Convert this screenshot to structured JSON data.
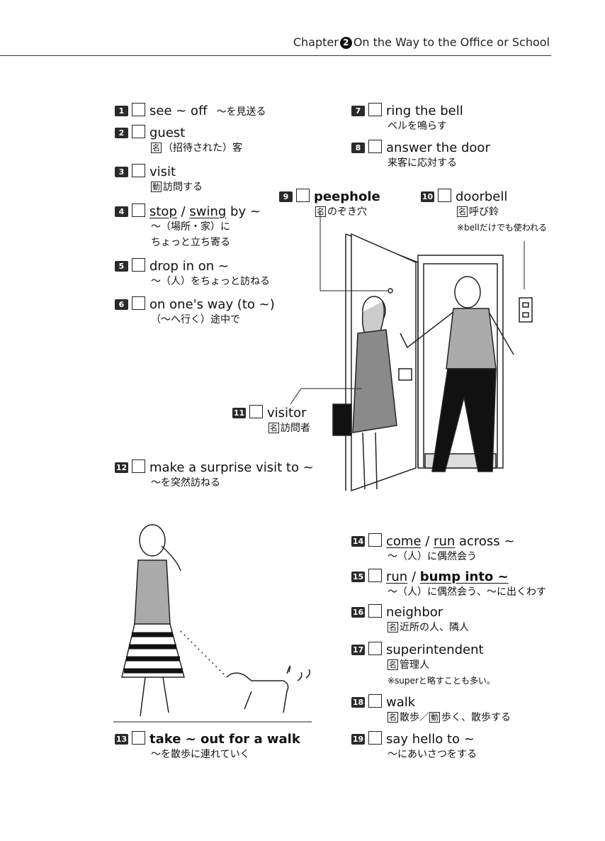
{
  "header": {
    "chapter_label": "Chapter",
    "chapter_number": "2",
    "chapter_title": "On the Way to the Office or School"
  },
  "entries": [
    {
      "n": "1",
      "en": "see ~ off",
      "jp": "～を見送る"
    },
    {
      "n": "2",
      "en": "guest",
      "pos": "名",
      "jp": "（招待された）客"
    },
    {
      "n": "3",
      "en": "visit",
      "pos": "動",
      "jp": "訪問する"
    },
    {
      "n": "4",
      "en_a": "stop",
      "en_sep": " / ",
      "en_b": "swing",
      "en_c": " by ~",
      "jp": "～（場所・家）に",
      "jp2": "ちょっと立ち寄る"
    },
    {
      "n": "5",
      "en": "drop in on ~",
      "jp": "～（人）をちょっと訪ねる"
    },
    {
      "n": "6",
      "en": "on one's way (to ~)",
      "jp": "（～へ行く）途中で"
    },
    {
      "n": "7",
      "en": "ring the bell",
      "jp": "ベルを鳴らす"
    },
    {
      "n": "8",
      "en": "answer the door",
      "jp": "来客に応対する"
    },
    {
      "n": "9",
      "en": "peephole",
      "pos": "名",
      "jp": "のぞき穴"
    },
    {
      "n": "10",
      "en": "doorbell",
      "pos": "名",
      "jp": "呼び鈴",
      "note": "※bellだけでも使われる"
    },
    {
      "n": "11",
      "en": "visitor",
      "pos": "名",
      "jp": "訪問者"
    },
    {
      "n": "12",
      "en": "make a surprise visit to ~",
      "jp": "～を突然訪ねる"
    },
    {
      "n": "13",
      "en": "take ~ out for a walk",
      "jp": "～を散歩に連れていく"
    },
    {
      "n": "14",
      "en_a": "come",
      "en_sep": " / ",
      "en_b": "run",
      "en_c": " across ~",
      "jp": "～（人）に偶然会う"
    },
    {
      "n": "15",
      "en_a": "run",
      "en_sep": " / ",
      "en_b": "bump into ~",
      "jp": "～（人）に偶然会う、～に出くわす"
    },
    {
      "n": "16",
      "en": "neighbor",
      "pos": "名",
      "jp": "近所の人、隣人"
    },
    {
      "n": "17",
      "en": "superintendent",
      "pos": "名",
      "jp": "管理人",
      "note": "※superと略すことも多い。"
    },
    {
      "n": "18",
      "en": "walk",
      "pos": "名",
      "jp": "散歩",
      "sep": "／",
      "pos2": "動",
      "jp2": "歩く、散歩する"
    },
    {
      "n": "19",
      "en": "say hello to ~",
      "jp": "～にあいさつをする"
    }
  ]
}
